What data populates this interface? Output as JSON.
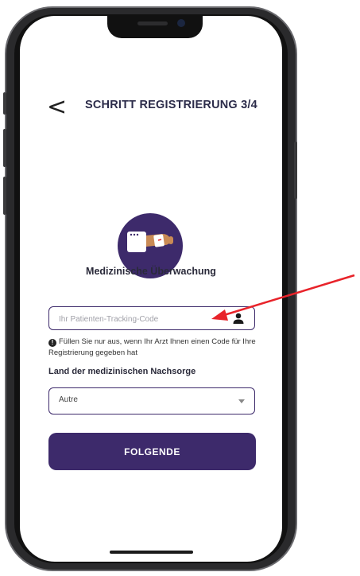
{
  "header": {
    "back_symbol": "<",
    "title": "SCHRITT REGISTRIERUNG 3/4"
  },
  "hero": {
    "icon": "medical-monitoring-illustration",
    "label": "Medizinische Überwachung"
  },
  "tracking_code": {
    "placeholder": "Ihr Patienten-Tracking-Code",
    "value": "",
    "icon": "person-icon"
  },
  "info": {
    "icon": "info-icon",
    "icon_symbol": "!",
    "text": "Füllen Sie nur aus, wenn Ihr Arzt Ihnen einen Code für Ihre Registrierung gegeben hat"
  },
  "country": {
    "label": "Land der medizinischen Nachsorge",
    "selected": "Autre"
  },
  "actions": {
    "next_label": "FOLGENDE"
  },
  "colors": {
    "primary": "#3d2a6b",
    "annotation_arrow": "#e8232a",
    "hand": "#c98a55"
  }
}
